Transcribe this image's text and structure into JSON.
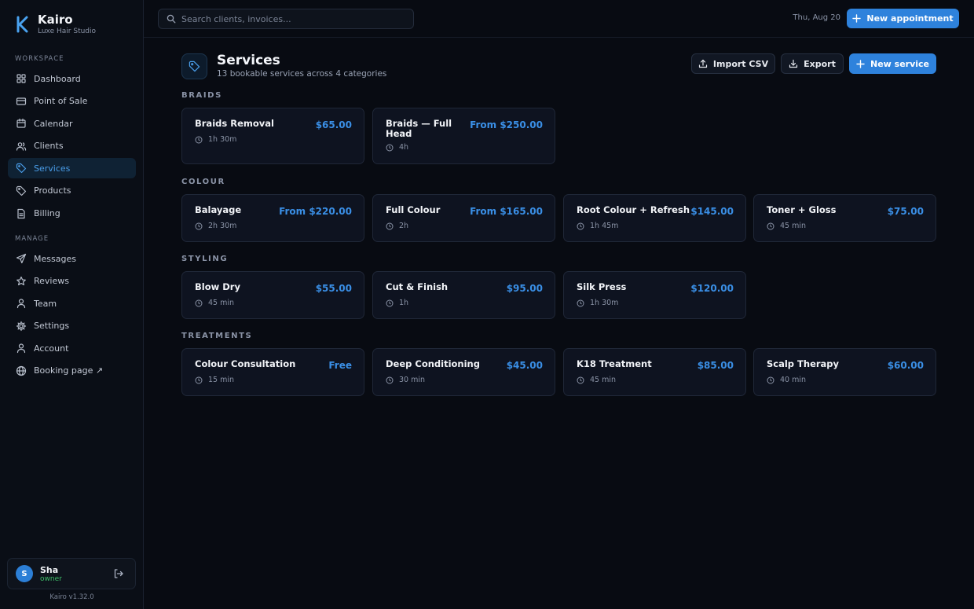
{
  "brand": {
    "name": "Kairo",
    "subtitle": "Luxe Hair Studio"
  },
  "sidebar": {
    "workspace_heading": "WORKSPACE",
    "workspace": [
      {
        "label": "Dashboard",
        "icon": "grid-icon"
      },
      {
        "label": "Point of Sale",
        "icon": "card-icon"
      },
      {
        "label": "Calendar",
        "icon": "calendar-icon"
      },
      {
        "label": "Clients",
        "icon": "users-icon"
      },
      {
        "label": "Services",
        "icon": "tag-icon",
        "active": true
      },
      {
        "label": "Products",
        "icon": "tag-icon"
      },
      {
        "label": "Billing",
        "icon": "file-icon"
      }
    ],
    "manage_heading": "MANAGE",
    "manage": [
      {
        "label": "Messages",
        "icon": "send-icon"
      },
      {
        "label": "Reviews",
        "icon": "star-icon"
      },
      {
        "label": "Team",
        "icon": "user-icon"
      },
      {
        "label": "Settings",
        "icon": "gear-icon"
      },
      {
        "label": "Account",
        "icon": "user-icon"
      },
      {
        "label": "Booking page ↗",
        "icon": "globe-icon"
      }
    ]
  },
  "user": {
    "initial": "S",
    "name": "Sha",
    "role": "owner"
  },
  "version": "Kairo v1.32.0",
  "topbar": {
    "search_placeholder": "Search clients, invoices...",
    "date": "Thu, Aug 20",
    "new_appointment": "New appointment"
  },
  "page": {
    "title": "Services",
    "subtitle": "13 bookable services across 4 categories",
    "import_label": "Import CSV",
    "export_label": "Export",
    "new_service_label": "New service"
  },
  "categories": [
    {
      "name": "BRAIDS",
      "services": [
        {
          "name": "Braids Removal",
          "price": "$65.00",
          "duration": "1h 30m"
        },
        {
          "name": "Braids — Full Head",
          "price": "From $250.00",
          "duration": "4h"
        }
      ]
    },
    {
      "name": "COLOUR",
      "services": [
        {
          "name": "Balayage",
          "price": "From $220.00",
          "duration": "2h 30m"
        },
        {
          "name": "Full Colour",
          "price": "From $165.00",
          "duration": "2h"
        },
        {
          "name": "Root Colour + Refresh",
          "price": "$145.00",
          "duration": "1h 45m"
        },
        {
          "name": "Toner + Gloss",
          "price": "$75.00",
          "duration": "45 min"
        }
      ]
    },
    {
      "name": "STYLING",
      "services": [
        {
          "name": "Blow Dry",
          "price": "$55.00",
          "duration": "45 min"
        },
        {
          "name": "Cut & Finish",
          "price": "$95.00",
          "duration": "1h"
        },
        {
          "name": "Silk Press",
          "price": "$120.00",
          "duration": "1h 30m"
        }
      ]
    },
    {
      "name": "TREATMENTS",
      "services": [
        {
          "name": "Colour Consultation",
          "price": "Free",
          "duration": "15 min"
        },
        {
          "name": "Deep Conditioning",
          "price": "$45.00",
          "duration": "30 min"
        },
        {
          "name": "K18 Treatment",
          "price": "$85.00",
          "duration": "45 min"
        },
        {
          "name": "Scalp Therapy",
          "price": "$60.00",
          "duration": "40 min"
        }
      ]
    }
  ],
  "colors": {
    "accent": "#2e82dc",
    "price": "#3a8fe6",
    "active_nav_bg": "#0f2234",
    "role": "#3fbf6a"
  }
}
